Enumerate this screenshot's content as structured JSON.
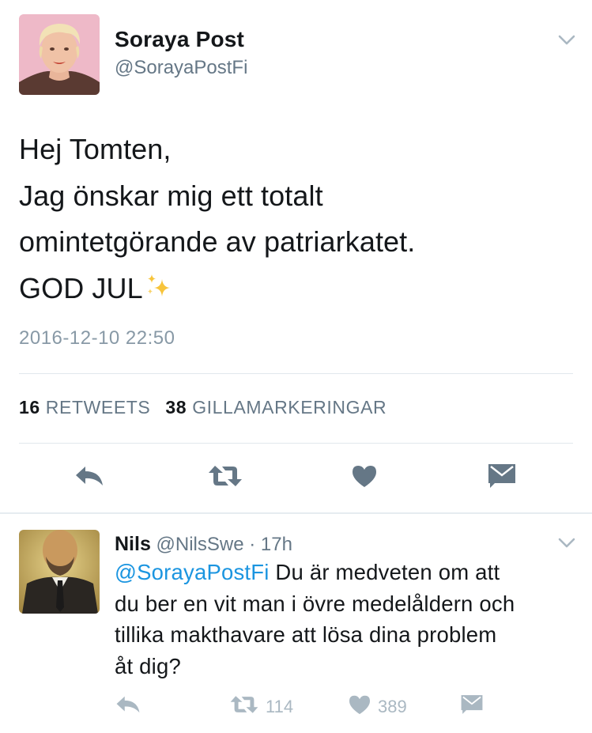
{
  "tweet": {
    "author_name": "Soraya Post",
    "author_handle": "@SorayaPostFi",
    "text_lines": [
      "Hej Tomten,",
      "Jag önskar mig ett totalt",
      "omintetgörande av patriarkatet.",
      "GOD JUL"
    ],
    "timestamp": "2016-12-10 22:50",
    "retweet_count": "16",
    "retweet_label": "RETWEETS",
    "like_count": "38",
    "like_label": "GILLAMARKERINGAR",
    "actions": [
      "reply-icon",
      "retweet-icon",
      "heart-icon",
      "direct-message-icon"
    ]
  },
  "reply": {
    "author_name": "Nils",
    "author_handle": "@NilsSwe",
    "time": "· 17h",
    "mention": "@SorayaPostFi",
    "text_lines": [
      " Du är medveten om att",
      "du ber en vit man i övre medelåldern och",
      "tillika makthavare att lösa dina problem",
      "åt dig?"
    ],
    "retweet_count": "114",
    "like_count": "389"
  },
  "colors": {
    "text": "#14171a",
    "secondary": "#657786",
    "link": "#1b95e0",
    "icon": "#657786",
    "icon_light": "#aab8c2",
    "divider": "#e1e8ed"
  }
}
